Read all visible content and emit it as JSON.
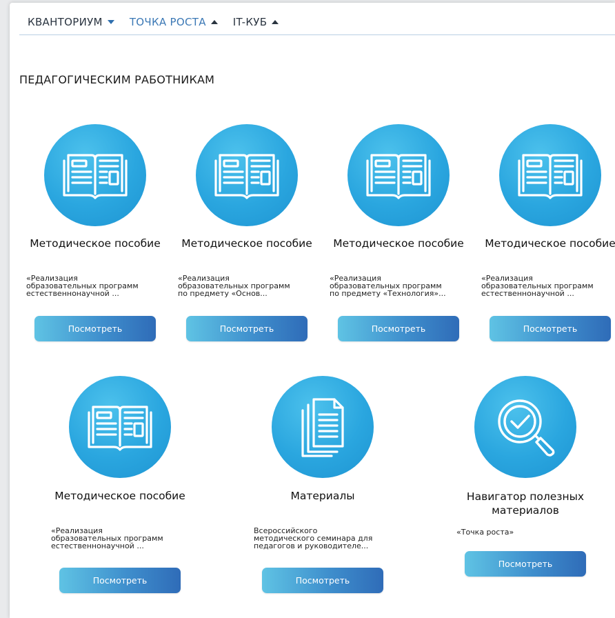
{
  "nav": {
    "items": [
      {
        "label": "КВАНТОРИУМ",
        "caret": "down",
        "active": false
      },
      {
        "label": "ТОЧКА РОСТА",
        "caret": "up",
        "active": true
      },
      {
        "label": "IT-КУБ",
        "caret": "up",
        "active": false
      }
    ]
  },
  "section": {
    "title": "ПЕДАГОГИЧЕСКИМ РАБОТНИКАМ"
  },
  "cards": [
    {
      "icon": "book-icon",
      "title": "Методическое пособие",
      "desc": "«Реализация\nобразовательных программ\nестественнонаучной ...",
      "button": "Посмотреть"
    },
    {
      "icon": "book-icon",
      "title": "Методическое пособие",
      "desc": "«Реализация\nобразовательных программ\nпо предмету «Основ...",
      "button": "Посмотреть"
    },
    {
      "icon": "book-icon",
      "title": "Методическое пособие",
      "desc": "«Реализация\nобразовательных программ\nпо предмету «Технология»...",
      "button": "Посмотреть"
    },
    {
      "icon": "book-icon",
      "title": "Методическое пособие",
      "desc": "«Реализация\nобразовательных программ\nестественнонаучной ...",
      "button": "Посмотреть"
    },
    {
      "icon": "book-icon",
      "title": "Методическое пособие",
      "desc": "«Реализация\nобразовательных программ\nестественнонаучной ...",
      "button": "Посмотреть"
    },
    {
      "icon": "documents-icon",
      "title": "Материалы",
      "desc": "Всероссийского\nметодического семинара для\nпедагогов и руководителе...",
      "button": "Посмотреть"
    },
    {
      "icon": "magnifier-check-icon",
      "title": "Навигатор полезных материалов",
      "desc": "«Точка роста»",
      "button": "Посмотреть"
    }
  ],
  "colors": {
    "accent": "#2aa6df",
    "button_start": "#5fc3e4",
    "button_end": "#2f6cb8",
    "nav_active": "#3b78b5"
  }
}
